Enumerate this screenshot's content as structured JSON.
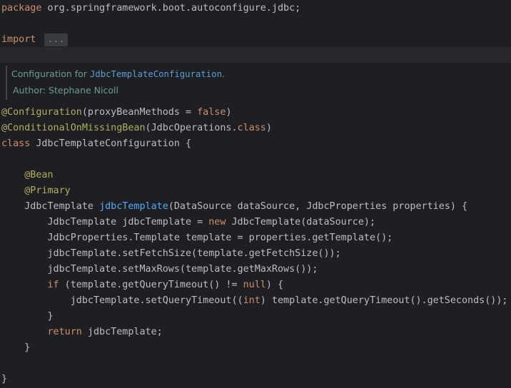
{
  "code": {
    "package_kw": "package",
    "package_name": " org.springframework.boot.autoconfigure.jdbc;",
    "import_kw": "import",
    "import_fold": "...",
    "doc": {
      "prefix": "Configuration for ",
      "link": "JdbcTemplateConfiguration",
      "suffix": ".",
      "author": "Author: Stephane Nicoll"
    },
    "ann_configuration": "@Configuration",
    "ann_configuration_args_open": "(proxyBeanMethods = ",
    "false_kw": "false",
    "ann_configuration_args_close": ")",
    "ann_conditional": "@ConditionalOnMissingBean",
    "ann_conditional_args_open": "(JdbcOperations.",
    "class_kw_inline": "class",
    "ann_conditional_args_close": ")",
    "class_kw": "class",
    "class_decl": " JdbcTemplateConfiguration {",
    "indent1": "    ",
    "indent2": "        ",
    "indent3": "            ",
    "ann_bean": "@Bean",
    "ann_primary": "@Primary",
    "method_return_type": "JdbcTemplate ",
    "method_name": "jdbcTemplate",
    "method_params": "(DataSource dataSource, JdbcProperties properties) {",
    "l1_a": "JdbcTemplate jdbcTemplate = ",
    "new_kw": "new",
    "l1_b": " JdbcTemplate(dataSource);",
    "l2": "JdbcProperties.Template template = properties.getTemplate();",
    "l3": "jdbcTemplate.setFetchSize(template.getFetchSize());",
    "l4": "jdbcTemplate.setMaxRows(template.getMaxRows());",
    "if_kw": "if",
    "l5_a": " (template.getQueryTimeout() != ",
    "null_kw": "null",
    "l5_b": ") {",
    "l6_a": "jdbcTemplate.setQueryTimeout((",
    "int_kw": "int",
    "l6_b": ") template.getQueryTimeout().getSeconds());",
    "close_brace": "}",
    "return_kw": "return",
    "l7": " jdbcTemplate;"
  }
}
